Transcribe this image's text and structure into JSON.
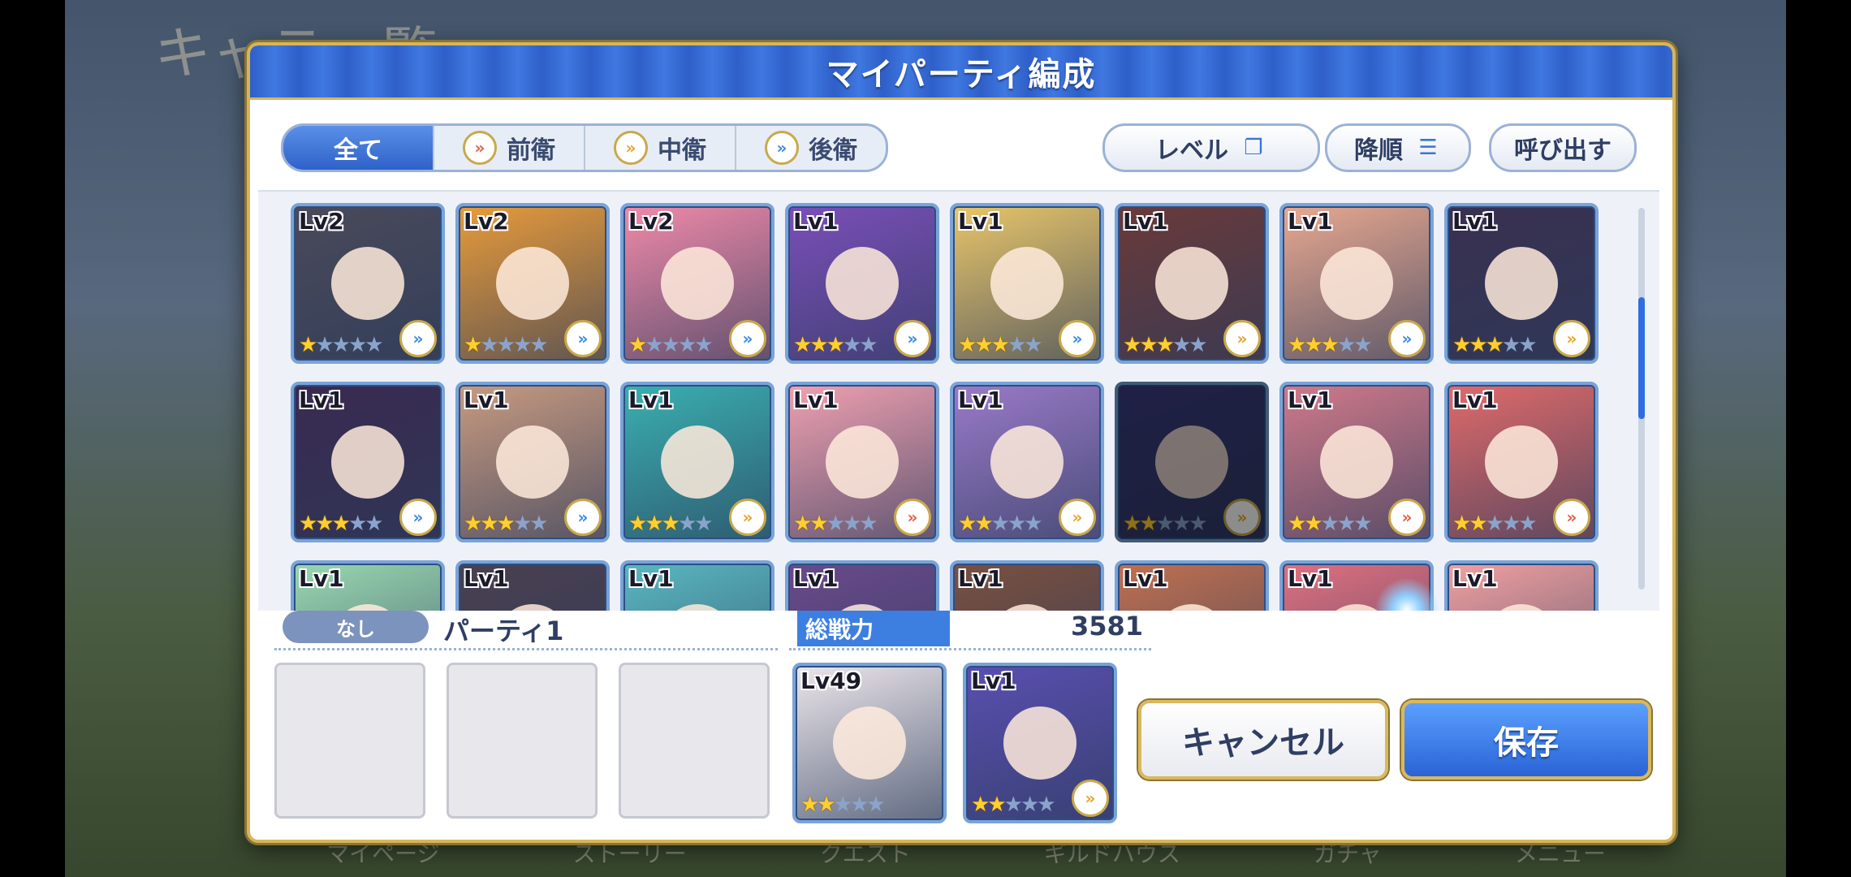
{
  "background": {
    "title": "キャラ一覧",
    "nav": [
      "マイページ",
      "ストーリー",
      "クエスト",
      "ギルドハウス",
      "ガチャ",
      "メニュー"
    ]
  },
  "dialog": {
    "title": "マイパーティ編成",
    "tabs": [
      {
        "label": "全て",
        "role": "all",
        "active": true
      },
      {
        "label": "前衛",
        "role": "front",
        "active": false
      },
      {
        "label": "中衛",
        "role": "mid",
        "active": false
      },
      {
        "label": "後衛",
        "role": "back",
        "active": false
      }
    ],
    "sort_label": "レベル",
    "order_label": "降順",
    "recall_label": "呼び出す"
  },
  "roster": [
    {
      "level": "Lv2",
      "stars": 1,
      "role": "back",
      "color": "#4a4a5a"
    },
    {
      "level": "Lv2",
      "stars": 1,
      "role": "back",
      "color": "#e89b3a"
    },
    {
      "level": "Lv2",
      "stars": 1,
      "role": "back",
      "color": "#f08aa8"
    },
    {
      "level": "Lv1",
      "stars": 3,
      "role": "back",
      "color": "#7a4fb8"
    },
    {
      "level": "Lv1",
      "stars": 3,
      "role": "back",
      "color": "#e8c56a"
    },
    {
      "level": "Lv1",
      "stars": 3,
      "role": "mid",
      "color": "#6a3a3a"
    },
    {
      "level": "Lv1",
      "stars": 3,
      "role": "back",
      "color": "#e8a890"
    },
    {
      "level": "Lv1",
      "stars": 3,
      "role": "mid",
      "color": "#3a3050"
    },
    {
      "level": "Lv1",
      "stars": 3,
      "role": "back",
      "color": "#3a2a50"
    },
    {
      "level": "Lv1",
      "stars": 3,
      "role": "back",
      "color": "#c89a80"
    },
    {
      "level": "Lv1",
      "stars": 3,
      "role": "mid",
      "color": "#3ab0b0"
    },
    {
      "level": "Lv1",
      "stars": 2,
      "role": "front",
      "color": "#f0a0b0"
    },
    {
      "level": "Lv1",
      "stars": 2,
      "role": "mid",
      "color": "#9a7ac8"
    },
    {
      "level": "",
      "stars": 2,
      "role": "mid",
      "color": "#3a3a80",
      "selected": true
    },
    {
      "level": "Lv1",
      "stars": 2,
      "role": "front",
      "color": "#d07a8a"
    },
    {
      "level": "Lv1",
      "stars": 2,
      "role": "front",
      "color": "#e06a6a"
    },
    {
      "level": "Lv1",
      "stars": 0,
      "role": "",
      "color": "#9ad8b0"
    },
    {
      "level": "Lv1",
      "stars": 0,
      "role": "",
      "color": "#4a4050"
    },
    {
      "level": "Lv1",
      "stars": 0,
      "role": "",
      "color": "#5ab8c0"
    },
    {
      "level": "Lv1",
      "stars": 0,
      "role": "",
      "color": "#6a4a8a"
    },
    {
      "level": "Lv1",
      "stars": 0,
      "role": "",
      "color": "#7a5040"
    },
    {
      "level": "Lv1",
      "stars": 0,
      "role": "",
      "color": "#c07050"
    },
    {
      "level": "Lv1",
      "stars": 0,
      "role": "",
      "color": "#e07080"
    },
    {
      "level": "Lv1",
      "stars": 0,
      "role": "",
      "color": "#f0a0a0"
    }
  ],
  "party": {
    "rank_badge": "なし",
    "name": "パーティ1",
    "power_label": "総戦力",
    "power_value": "3581",
    "members": [
      {
        "level": "Lv49",
        "stars": 2,
        "role": "",
        "color": "#ece6ea"
      },
      {
        "level": "Lv1",
        "stars": 2,
        "role": "mid",
        "color": "#5a4fb0"
      }
    ]
  },
  "buttons": {
    "cancel": "キャンセル",
    "save": "保存"
  }
}
